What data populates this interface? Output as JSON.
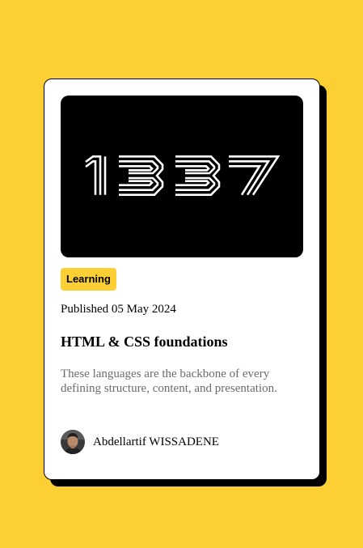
{
  "card": {
    "image": {
      "alt": "1337",
      "logo_text": "1337"
    },
    "tag": "Learning",
    "published": "Published 05 May 2024",
    "title": "HTML & CSS foundations",
    "description": "These languages are the backbone of every defining structure, content, and presentation.",
    "author": {
      "name": "Abdellartif WISSADENE",
      "avatar_icon": "person-avatar"
    }
  },
  "colors": {
    "background": "#FCD034",
    "card": "#FFFFFF",
    "shadow": "#000000",
    "tag_background": "#FCD034",
    "description_text": "#6B6B6B"
  }
}
